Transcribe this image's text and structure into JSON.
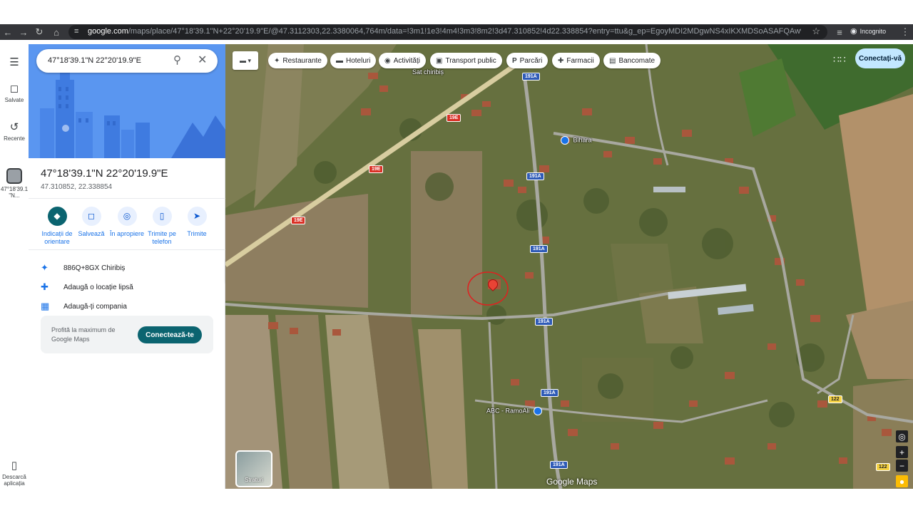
{
  "browser": {
    "url_host": "google.com",
    "url_rest": "/maps/place/47°18'39.1\"N+22°20'19.9\"E/@47.3112303,22.3380064,764m/data=!3m1!1e3!4m4!3m3!8m2!3d47.310852!4d22.338854?entry=ttu&g_ep=EgoyMDI2MDgwNS4xIKXMDSoASAFQAw%3D%3D",
    "profile_label": "Incognito"
  },
  "rail": {
    "saved": "Salvate",
    "recent": "Recente",
    "place_line1": "47°18'39.1",
    "place_line2": "\"N...",
    "download_line1": "Descarcă",
    "download_line2": "aplicația"
  },
  "search": {
    "query": "47°18'39.1\"N 22°20'19.9\"E"
  },
  "place": {
    "title": "47°18'39.1\"N 22°20'19.9\"E",
    "decimal": "47.310852, 22.338854"
  },
  "actions": [
    {
      "line1": "Indicații de",
      "line2": "orientare"
    },
    {
      "line1": "Salvează",
      "line2": ""
    },
    {
      "line1": "În apropiere",
      "line2": ""
    },
    {
      "line1": "Trimite pe",
      "line2": "telefon"
    },
    {
      "line1": "Trimite",
      "line2": ""
    }
  ],
  "info": {
    "plus_code": "886Q+8GX Chiribiș",
    "add_place": "Adaugă o locație lipsă",
    "add_business": "Adaugă-ți compania"
  },
  "promo": {
    "text": "Profită la maximum de Google Maps",
    "button": "Conectează-te"
  },
  "chips": [
    "Restaurante",
    "Hoteluri",
    "Activități",
    "Transport public",
    "Parcări",
    "Farmacii",
    "Bancomate"
  ],
  "map": {
    "signin": "Conectați-vă",
    "layers": "Straturi",
    "brand": "Google Maps",
    "labels": {
      "village": "Sat chiribiș",
      "bihara": "Bihara",
      "abc": "ABC - RamoAli"
    },
    "road_shields": {
      "r191a": "191A",
      "r19e": "19E",
      "r122": "122"
    }
  },
  "colors": {
    "accent": "#0b6470",
    "link": "#1a73e8",
    "pin": "#ea4335",
    "signin_bg": "#c2e7ff"
  }
}
